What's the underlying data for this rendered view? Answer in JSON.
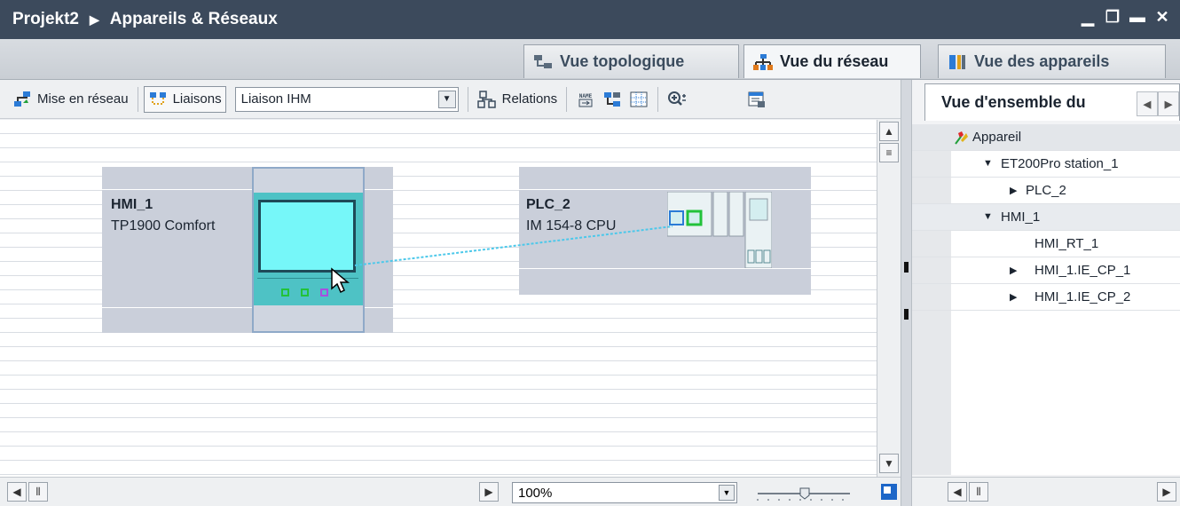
{
  "window": {
    "project": "Projekt2",
    "breadcrumb_sep": "▶",
    "title": "Appareils & Réseaux",
    "controls": [
      "▁",
      "❐",
      "▬",
      "✕"
    ]
  },
  "view_tabs": [
    {
      "label": "Vue topologique",
      "icon": "topology-icon",
      "active": false
    },
    {
      "label": "Vue du réseau",
      "icon": "network-icon",
      "active": true
    },
    {
      "label": "Vue des appareils",
      "icon": "devices-icon",
      "active": false
    }
  ],
  "toolbar": {
    "networking_label": "Mise en réseau",
    "connections_label": "Liaisons",
    "connection_type": "Liaison IHM",
    "relations_label": "Relations",
    "name_icon_text": "NAME"
  },
  "devices": [
    {
      "name": "HMI_1",
      "type": "TP1900 Comfort"
    },
    {
      "name": "PLC_2",
      "type": "IM 154-8 CPU"
    }
  ],
  "zoom": {
    "value": "100%"
  },
  "overview": {
    "title": "Vue d'ensemble du",
    "column_header": "Appareil",
    "rows": [
      {
        "label": "ET200Pro station_1",
        "expander": "▼"
      },
      {
        "label": "PLC_2",
        "expander": "▶"
      },
      {
        "label": "HMI_1",
        "expander": "▼"
      },
      {
        "label": "HMI_RT_1",
        "expander": ""
      },
      {
        "label": "HMI_1.IE_CP_1",
        "expander": "▶"
      },
      {
        "label": "HMI_1.IE_CP_2",
        "expander": "▶"
      }
    ]
  },
  "colors": {
    "title_bar": "#3c4a5c",
    "device_bg": "#cacfda",
    "hmi_screen": "#76f7f9",
    "hmi_body": "#4ec2c5",
    "connection_line": "#4cc8ea",
    "port_green": "#22c23a",
    "port_purple": "#a74fe0"
  }
}
